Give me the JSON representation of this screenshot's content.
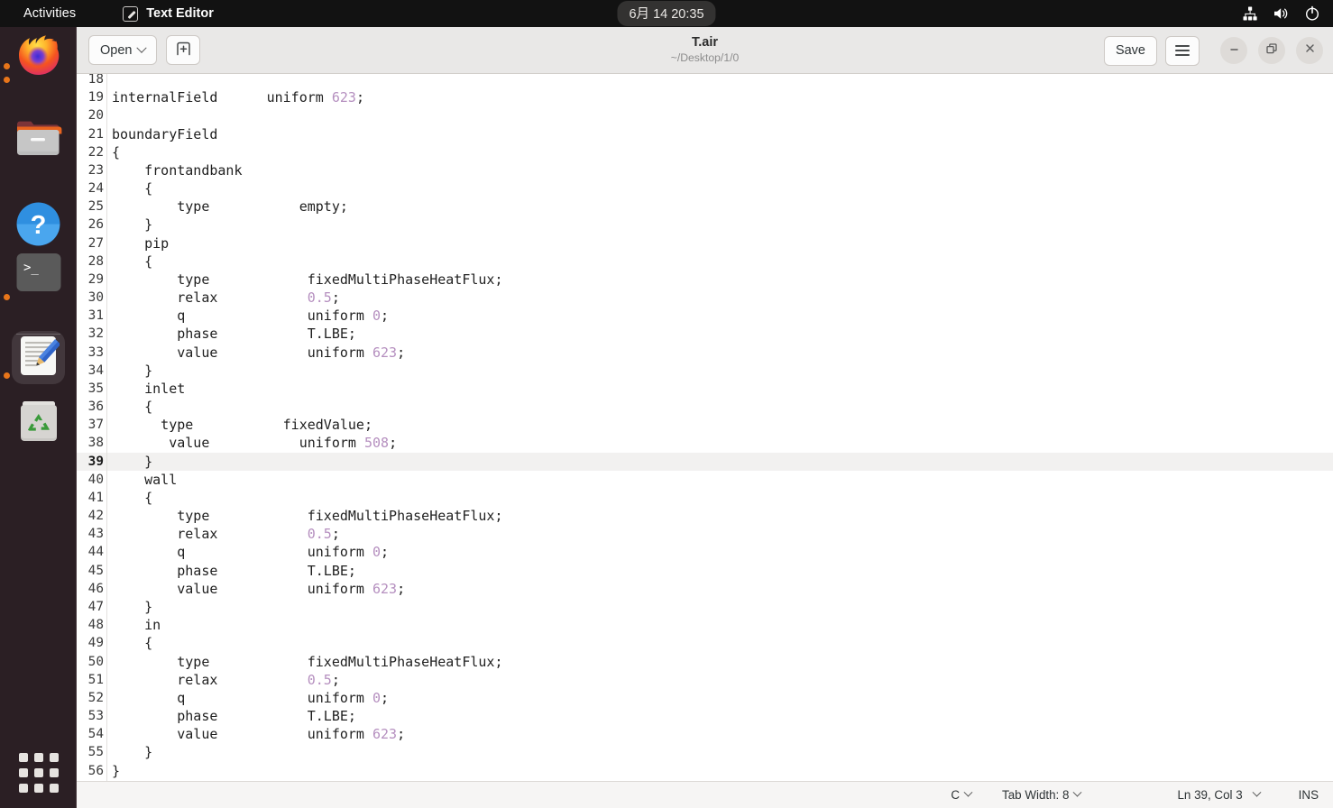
{
  "topbar": {
    "activities": "Activities",
    "app_name": "Text Editor",
    "app_icon": "text-editor-icon",
    "clock": "6月 14 20:35",
    "sys_icons": [
      "network-icon",
      "volume-icon",
      "power-icon"
    ]
  },
  "dock": {
    "items": [
      {
        "name": "firefox",
        "label": "Firefox",
        "running": false,
        "active": false
      },
      {
        "name": "files",
        "label": "Files",
        "running": true,
        "active": false
      },
      {
        "name": "help",
        "label": "Help",
        "running": false,
        "active": false
      },
      {
        "name": "terminal",
        "label": "Terminal",
        "running": true,
        "active": false
      },
      {
        "name": "text-editor",
        "label": "Text Editor",
        "running": true,
        "active": true
      },
      {
        "name": "trash",
        "label": "Trash",
        "running": false,
        "active": false
      }
    ],
    "show_apps": "Show Applications"
  },
  "header": {
    "open_label": "Open",
    "new_tab_icon": "new-tab-icon",
    "title": "T.air",
    "subtitle": "~/Desktop/1/0",
    "save_label": "Save",
    "menu_icon": "hamburger-menu-icon",
    "minimize_icon": "minimize-icon",
    "maximize_icon": "maximize-icon",
    "close_icon": "close-icon"
  },
  "editor": {
    "current_line": 39,
    "first_visible_line": 18,
    "lines": [
      {
        "n": 18,
        "parts": []
      },
      {
        "n": 19,
        "parts": [
          {
            "t": "internalField      uniform "
          },
          {
            "t": "623",
            "c": "num"
          },
          {
            "t": ";"
          }
        ]
      },
      {
        "n": 20,
        "parts": []
      },
      {
        "n": 21,
        "parts": [
          {
            "t": "boundaryField"
          }
        ]
      },
      {
        "n": 22,
        "parts": [
          {
            "t": "{"
          }
        ]
      },
      {
        "n": 23,
        "parts": [
          {
            "t": "    frontandbank"
          }
        ]
      },
      {
        "n": 24,
        "parts": [
          {
            "t": "    {"
          }
        ]
      },
      {
        "n": 25,
        "parts": [
          {
            "t": "        type           empty;"
          }
        ]
      },
      {
        "n": 26,
        "parts": [
          {
            "t": "    }"
          }
        ]
      },
      {
        "n": 27,
        "parts": [
          {
            "t": "    pip"
          }
        ]
      },
      {
        "n": 28,
        "parts": [
          {
            "t": "    {"
          }
        ]
      },
      {
        "n": 29,
        "parts": [
          {
            "t": "        type            fixedMultiPhaseHeatFlux;"
          }
        ]
      },
      {
        "n": 30,
        "parts": [
          {
            "t": "        relax           "
          },
          {
            "t": "0.5",
            "c": "num"
          },
          {
            "t": ";"
          }
        ]
      },
      {
        "n": 31,
        "parts": [
          {
            "t": "        q               uniform "
          },
          {
            "t": "0",
            "c": "num"
          },
          {
            "t": ";"
          }
        ]
      },
      {
        "n": 32,
        "parts": [
          {
            "t": "        phase           T.LBE;"
          }
        ]
      },
      {
        "n": 33,
        "parts": [
          {
            "t": "        value           uniform "
          },
          {
            "t": "623",
            "c": "num"
          },
          {
            "t": ";"
          }
        ]
      },
      {
        "n": 34,
        "parts": [
          {
            "t": "    }"
          }
        ]
      },
      {
        "n": 35,
        "parts": [
          {
            "t": "    inlet"
          }
        ]
      },
      {
        "n": 36,
        "parts": [
          {
            "t": "    {"
          }
        ]
      },
      {
        "n": 37,
        "parts": [
          {
            "t": "      type           fixedValue;"
          }
        ]
      },
      {
        "n": 38,
        "parts": [
          {
            "t": "       value           uniform "
          },
          {
            "t": "508",
            "c": "num"
          },
          {
            "t": ";"
          }
        ]
      },
      {
        "n": 39,
        "parts": [
          {
            "t": "    }"
          }
        ]
      },
      {
        "n": 40,
        "parts": [
          {
            "t": "    wall"
          }
        ]
      },
      {
        "n": 41,
        "parts": [
          {
            "t": "    {"
          }
        ]
      },
      {
        "n": 42,
        "parts": [
          {
            "t": "        type            fixedMultiPhaseHeatFlux;"
          }
        ]
      },
      {
        "n": 43,
        "parts": [
          {
            "t": "        relax           "
          },
          {
            "t": "0.5",
            "c": "num"
          },
          {
            "t": ";"
          }
        ]
      },
      {
        "n": 44,
        "parts": [
          {
            "t": "        q               uniform "
          },
          {
            "t": "0",
            "c": "num"
          },
          {
            "t": ";"
          }
        ]
      },
      {
        "n": 45,
        "parts": [
          {
            "t": "        phase           T.LBE;"
          }
        ]
      },
      {
        "n": 46,
        "parts": [
          {
            "t": "        value           uniform "
          },
          {
            "t": "623",
            "c": "num"
          },
          {
            "t": ";"
          }
        ]
      },
      {
        "n": 47,
        "parts": [
          {
            "t": "    }"
          }
        ]
      },
      {
        "n": 48,
        "parts": [
          {
            "t": "    in"
          }
        ]
      },
      {
        "n": 49,
        "parts": [
          {
            "t": "    {"
          }
        ]
      },
      {
        "n": 50,
        "parts": [
          {
            "t": "        type            fixedMultiPhaseHeatFlux;"
          }
        ]
      },
      {
        "n": 51,
        "parts": [
          {
            "t": "        relax           "
          },
          {
            "t": "0.5",
            "c": "num"
          },
          {
            "t": ";"
          }
        ]
      },
      {
        "n": 52,
        "parts": [
          {
            "t": "        q               uniform "
          },
          {
            "t": "0",
            "c": "num"
          },
          {
            "t": ";"
          }
        ]
      },
      {
        "n": 53,
        "parts": [
          {
            "t": "        phase           T.LBE;"
          }
        ]
      },
      {
        "n": 54,
        "parts": [
          {
            "t": "        value           uniform "
          },
          {
            "t": "623",
            "c": "num"
          },
          {
            "t": ";"
          }
        ]
      },
      {
        "n": 55,
        "parts": [
          {
            "t": "    }"
          }
        ]
      },
      {
        "n": 56,
        "parts": [
          {
            "t": "}"
          }
        ]
      }
    ]
  },
  "statusbar": {
    "language": "C",
    "tab_width": "Tab Width: 8",
    "position": "Ln 39, Col 3",
    "insert_mode": "INS"
  },
  "colors": {
    "accent_orange": "#e8751a",
    "number_literal": "#b58fbf",
    "current_line_bg": "#f2f1f0",
    "headerbar_bg": "#e9e8e7",
    "dock_bg": "#2b1f24",
    "topbar_bg": "#121212"
  }
}
